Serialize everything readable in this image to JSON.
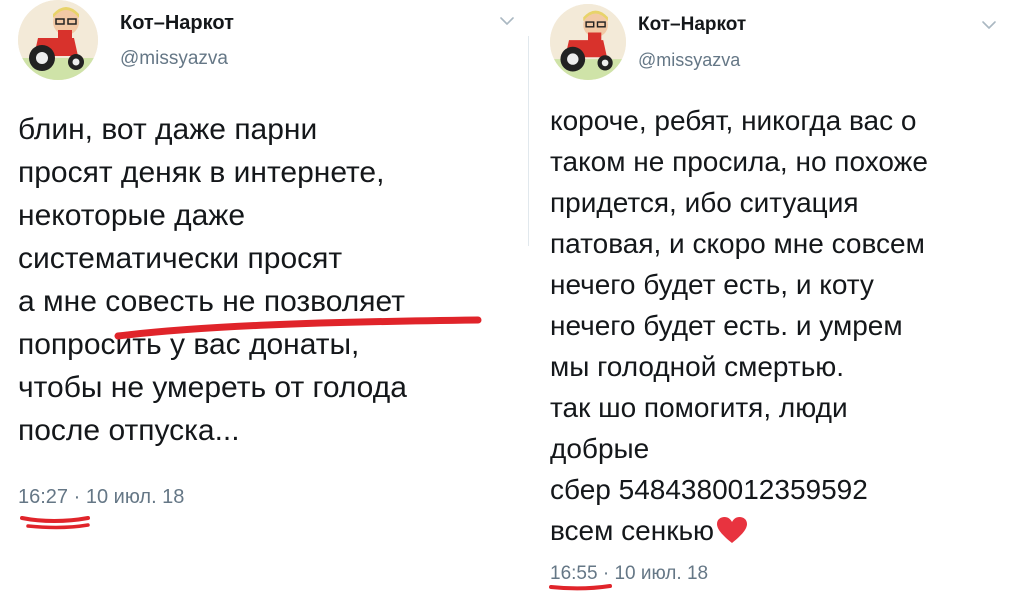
{
  "tweets": [
    {
      "author": {
        "name": "Кот–Наркот",
        "handle": "@missyazva"
      },
      "text_lines": [
        "блин, вот даже парни",
        "просят деняк в интернете,",
        "некоторые даже",
        "систематически просят",
        "а мне совесть не позволяет",
        "попросить у вас донаты,",
        "чтобы не умереть от голода",
        "после отпуска..."
      ],
      "time": "16:27",
      "separator": "·",
      "date": "10 июл. 18"
    },
    {
      "author": {
        "name": "Кот–Наркот",
        "handle": "@missyazva"
      },
      "text_lines": [
        "короче, ребят, никогда вас о",
        "таком не просила, но похоже",
        "придется, ибо ситуация",
        "патовая, и скоро мне совсем",
        "нечего будет есть, и коту",
        "нечего будет есть. и умрем",
        "мы голодной смертью.",
        "так шо помогитя, люди",
        "добрые",
        "сбер 5484380012359592",
        "всем сенкью"
      ],
      "time": "16:55",
      "separator": "·",
      "date": "10 июл. 18"
    }
  ],
  "icons": {
    "menu": "chevron-down-icon",
    "heart": "red-heart-emoji",
    "avatar": "tractor-avatar"
  },
  "colors": {
    "text": "#14171a",
    "secondary": "#657786",
    "annotation": "#e0242a",
    "heart": "#e8333f"
  }
}
